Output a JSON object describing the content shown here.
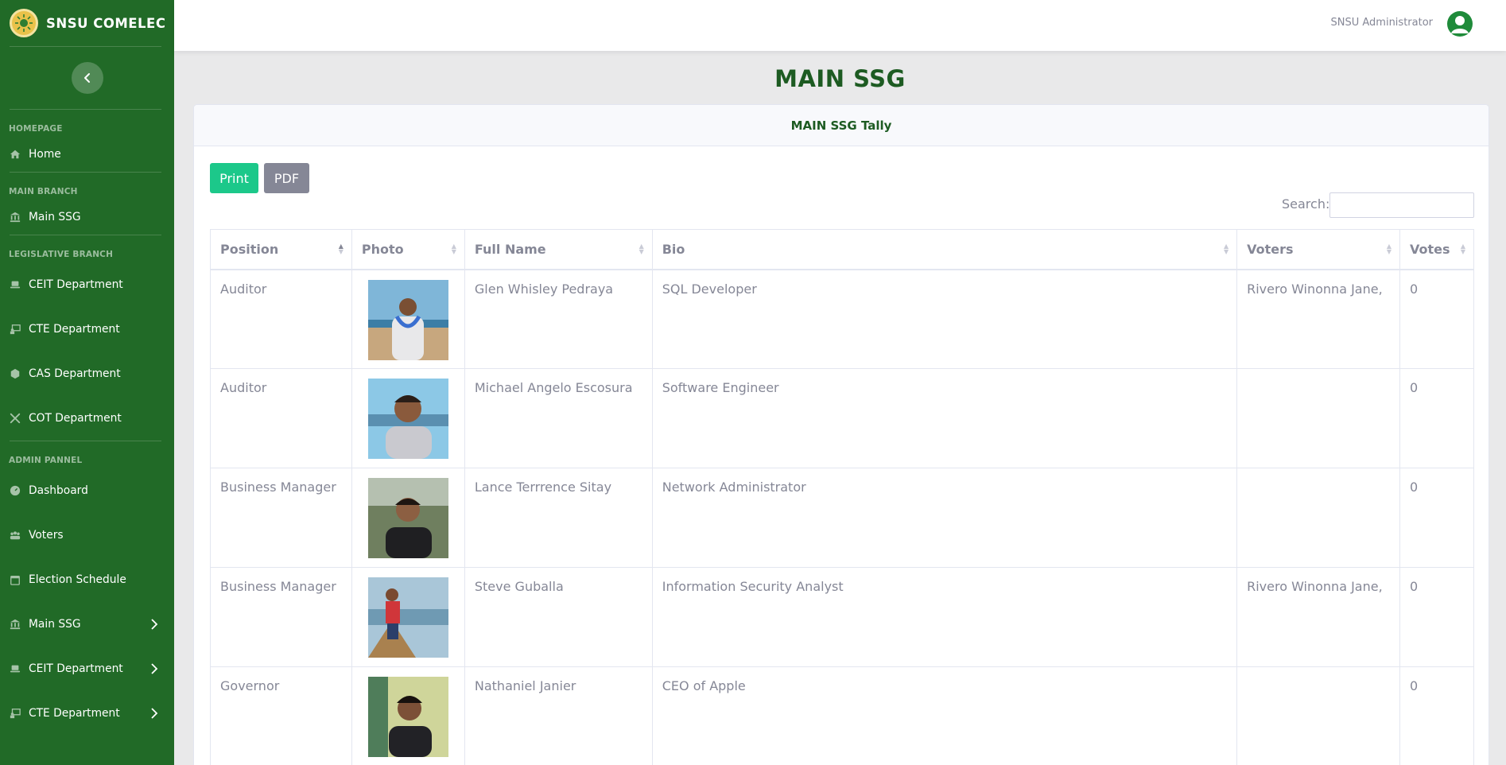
{
  "sidebar": {
    "brand": "SNSU COMELEC",
    "sections": [
      {
        "heading": "HOMEPAGE",
        "items": [
          {
            "label": "Home",
            "icon": "home-icon"
          }
        ]
      },
      {
        "heading": "MAIN BRANCH",
        "items": [
          {
            "label": "Main SSG",
            "icon": "landmark-icon"
          }
        ]
      },
      {
        "heading": "LEGISLATIVE BRANCH",
        "items": [
          {
            "label": "CEIT Department",
            "icon": "laptop-icon"
          },
          {
            "label": "CTE Department",
            "icon": "chalkboard-teacher-icon"
          },
          {
            "label": "CAS Department",
            "icon": "atom-icon"
          },
          {
            "label": "COT Department",
            "icon": "tools-icon"
          }
        ]
      },
      {
        "heading": "ADMIN PANNEL",
        "items": [
          {
            "label": "Dashboard",
            "icon": "tachometer-icon"
          },
          {
            "label": "Voters",
            "icon": "users-icon"
          },
          {
            "label": "Election Schedule",
            "icon": "calendar-icon"
          },
          {
            "label": "Main SSG",
            "icon": "landmark-icon",
            "has_submenu": true
          },
          {
            "label": "CEIT Department",
            "icon": "laptop-icon",
            "has_submenu": true
          },
          {
            "label": "CTE Department",
            "icon": "chalkboard-teacher-icon",
            "has_submenu": true
          }
        ]
      }
    ]
  },
  "topbar": {
    "user_name": "SNSU Administrator",
    "avatar_icon": "user-circle-icon"
  },
  "page": {
    "title": "MAIN SSG"
  },
  "card": {
    "title": "MAIN SSG Tally",
    "print_label": "Print",
    "pdf_label": "PDF",
    "search_label": "Search:",
    "search_value": ""
  },
  "table": {
    "columns": [
      "Position",
      "Photo",
      "Full Name",
      "Bio",
      "Voters",
      "Votes"
    ],
    "rows": [
      {
        "position": "Auditor",
        "name": "Glen Whisley Pedraya",
        "bio": "SQL Developer",
        "voters": "Rivero Winonna Jane,",
        "votes": "0"
      },
      {
        "position": "Auditor",
        "name": "Michael Angelo Escosura",
        "bio": "Software Engineer",
        "voters": "",
        "votes": "0"
      },
      {
        "position": "Business Manager",
        "name": "Lance Terrrence Sitay",
        "bio": "Network Administrator",
        "voters": "",
        "votes": "0"
      },
      {
        "position": "Business Manager",
        "name": "Steve Guballa",
        "bio": "Information Security Analyst",
        "voters": "Rivero Winonna Jane,",
        "votes": "0"
      },
      {
        "position": "Governor",
        "name": "Nathaniel Janier",
        "bio": "CEO of Apple",
        "voters": "",
        "votes": "0"
      }
    ]
  },
  "colors": {
    "sidebar": "#216a27",
    "accent_title": "#1d5b22",
    "print_button": "#1cc88a",
    "pdf_button": "#858796"
  }
}
